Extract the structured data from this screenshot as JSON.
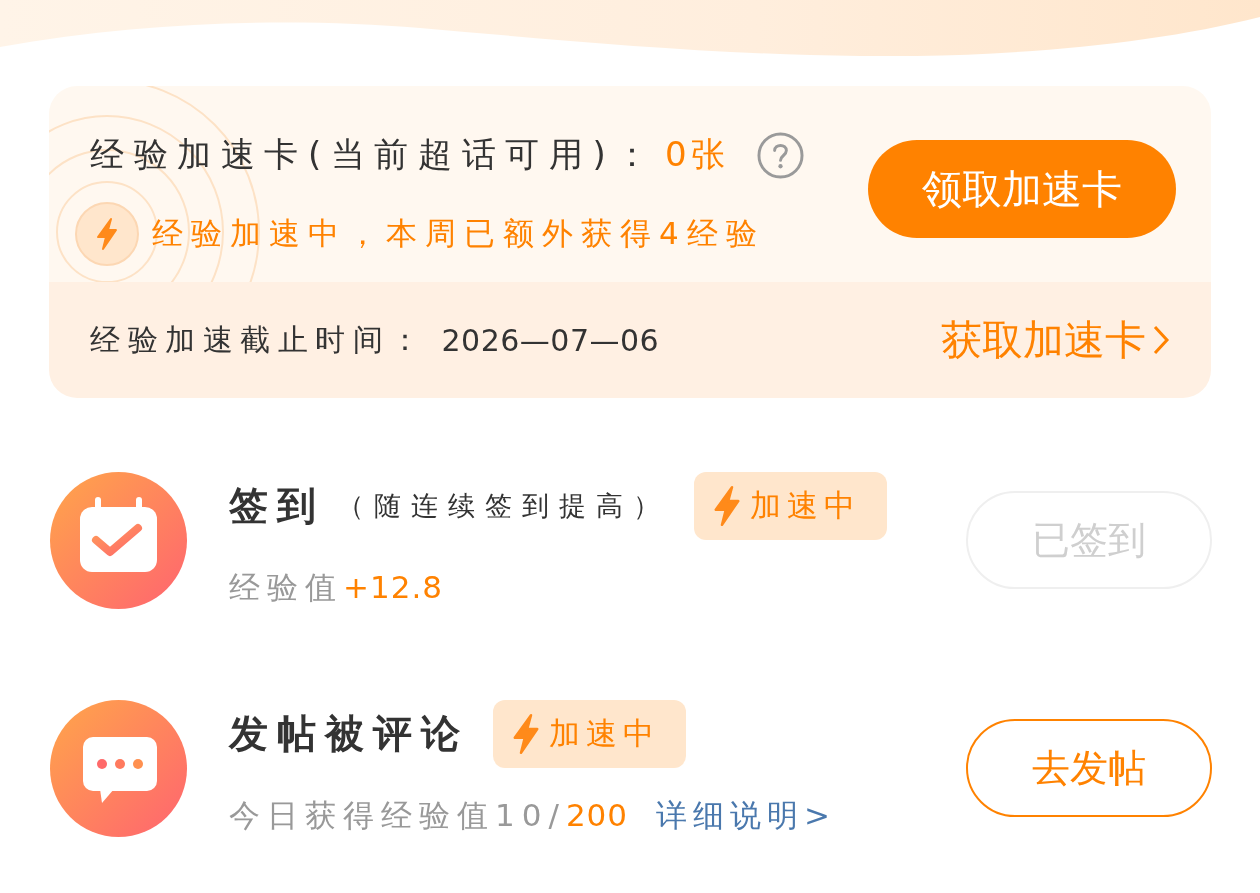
{
  "boost_card": {
    "title": "经验加速卡(当前超话可用)：",
    "count": "0张",
    "status": "经验加速中，本周已额外获得4经验",
    "claim_button": "领取加速卡",
    "deadline_label": "经验加速截止时间：",
    "deadline": "2026—07—06",
    "get_link": "获取加速卡"
  },
  "tasks": [
    {
      "kind": "calendar",
      "title": "签到",
      "note": "（随连续签到提高）",
      "badge": "加速中",
      "reward_label": "经验值",
      "reward_value": "+12.8",
      "button": {
        "label": "已签到",
        "disabled": true
      }
    },
    {
      "kind": "comment",
      "title": "发帖被评论",
      "badge": "加速中",
      "reward_label": "今日获得经验值10/",
      "reward_value": "200",
      "link": "详细说明>",
      "button": {
        "label": "去发帖",
        "disabled": false
      }
    }
  ]
}
